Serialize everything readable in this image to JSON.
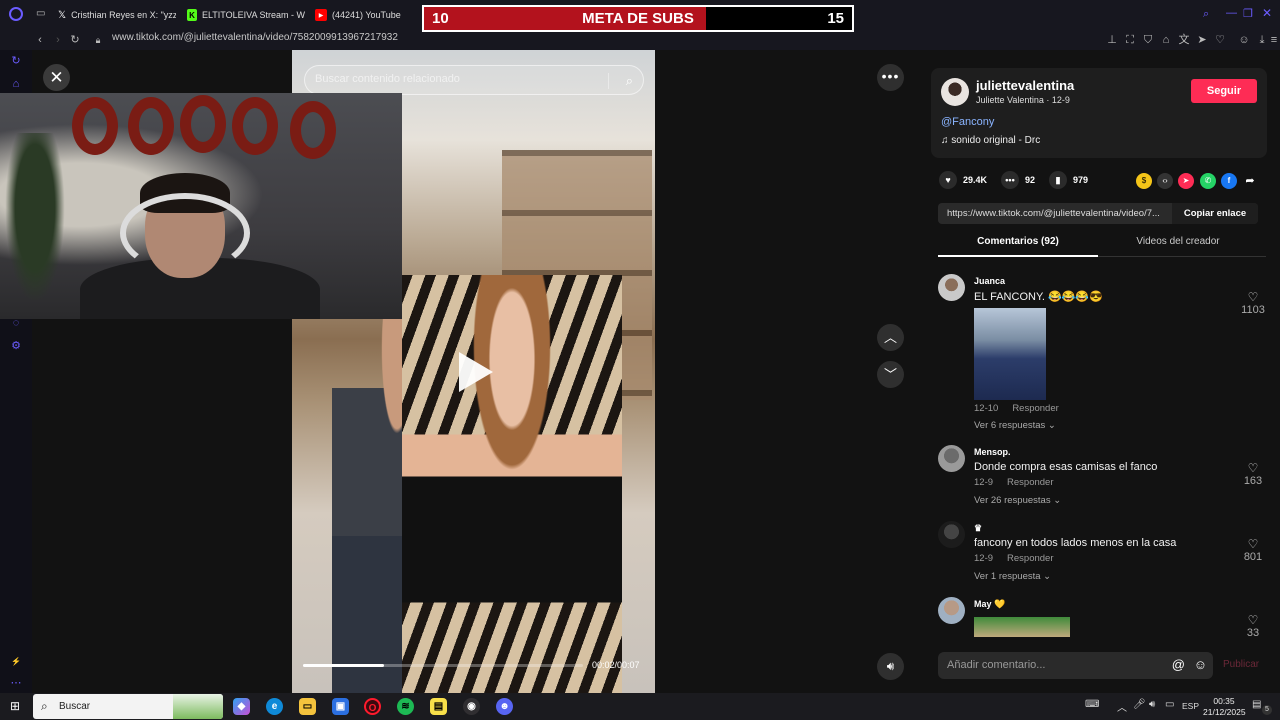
{
  "browser": {
    "tabs": [
      {
        "label": "Cristhian Reyes en X: \"yzz",
        "icon": "x-logo-icon"
      },
      {
        "label": "ELTITOLEIVA Stream - W",
        "icon": "kick-logo-icon"
      },
      {
        "label": "(44241) YouTube",
        "icon": "youtube-logo-icon"
      }
    ],
    "url": "www.tiktok.com/@juliettevalentina/video/7582009913967217932"
  },
  "subs_goal": {
    "current": "10",
    "title": "META DE SUBS",
    "goal": "15",
    "progress_fraction": 0.66,
    "fill_color": "#b3121d"
  },
  "video": {
    "search_placeholder": "Buscar contenido relacionado",
    "time": "00:02/00:07",
    "progress_fraction": 0.29
  },
  "creator": {
    "handle": "juliettevalentina",
    "subline": "Juliette Valentina · 12-9",
    "follow_label": "Seguir",
    "mention": "@Fancony",
    "sound": "sonido original - Drc",
    "accent": "#fe2c55"
  },
  "stats": {
    "likes": "29.4K",
    "comments": "92",
    "saves": "979"
  },
  "share": {
    "url": "https://www.tiktok.com/@juliettevalentina/video/7...",
    "copy_label": "Copiar enlace"
  },
  "tabs": {
    "comments": "Comentarios (92)",
    "creator_videos": "Videos del creador"
  },
  "comments": [
    {
      "user": "Juanca",
      "text": "EL FANCONY. 😂😂😂😎",
      "date": "12-10",
      "reply": "Responder",
      "replies": "Ver 6 respuestas",
      "likes": "1103"
    },
    {
      "user": "Mensop.",
      "text": "Donde compra esas camisas el fanco",
      "date": "12-9",
      "reply": "Responder",
      "replies": "Ver 26 respuestas",
      "likes": "163"
    },
    {
      "user": "♛",
      "text": "fancony en todos lados menos en la casa",
      "date": "12-9",
      "reply": "Responder",
      "replies": "Ver 1 respuesta",
      "likes": "801"
    },
    {
      "user": "May 💛",
      "likes": "33"
    }
  ],
  "comment_input": {
    "placeholder": "Añadir comentario...",
    "publish": "Publicar"
  },
  "taskbar": {
    "search": "Buscar",
    "lang": "ESP",
    "time": "00:35",
    "date": "21/12/2025",
    "notif_count": "5"
  }
}
